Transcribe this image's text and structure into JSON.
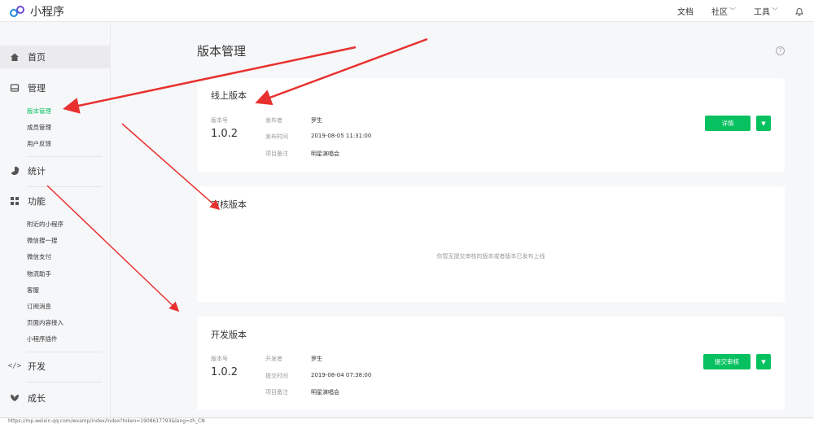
{
  "app": {
    "title": "小程序"
  },
  "topnav": {
    "docs": "文档",
    "community": "社区",
    "tools": "工具"
  },
  "sidebar": {
    "home": "首页",
    "manage": "管理",
    "manage_items": [
      "版本管理",
      "成员管理",
      "用户反馈"
    ],
    "stats": "统计",
    "features": "功能",
    "feature_items": [
      "附近的小程序",
      "微信搜一搜",
      "微信支付",
      "物流助手",
      "客服",
      "订阅消息",
      "页面内容接入",
      "小程序插件"
    ],
    "dev": "开发",
    "growth": "成长"
  },
  "page": {
    "title": "版本管理"
  },
  "online": {
    "title": "线上版本",
    "version_label": "版本号",
    "version": "1.0.2",
    "publisher_label": "发布者",
    "publisher": "罗生",
    "time_label": "发布时间",
    "time": "2019-08-05 11:31:00",
    "note_label": "项目备注",
    "note": "明星演唱会",
    "button": "详情"
  },
  "review": {
    "title": "审核版本",
    "empty": "你暂无提交审核的版本或者版本已发布上线"
  },
  "dev": {
    "title": "开发版本",
    "version_label": "版本号",
    "version": "1.0.2",
    "developer_label": "开发者",
    "developer": "罗生",
    "time_label": "提交时间",
    "time": "2019-08-04 07:38:00",
    "note_label": "项目备注",
    "note": "明星演唱会",
    "button": "提交审核"
  },
  "statusbar": {
    "url": "https://mp.weixin.qq.com/wxamp/index/index?token=1908617793&lang=zh_CN"
  },
  "colors": {
    "accent": "#07c160",
    "arrow": "#e8312f"
  }
}
